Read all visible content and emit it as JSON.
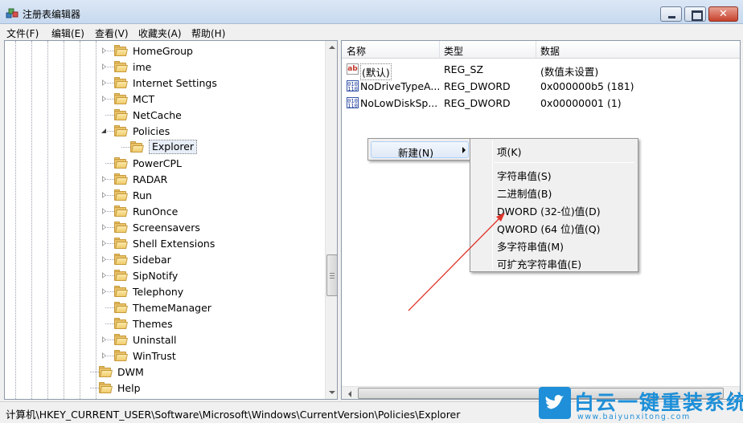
{
  "window": {
    "title": "注册表编辑器",
    "controls": {
      "minimize": "minimize",
      "maximize": "maximize",
      "close": "✕"
    }
  },
  "menu": [
    "文件(F)",
    "编辑(E)",
    "查看(V)",
    "收藏夹(A)",
    "帮助(H)"
  ],
  "tree": {
    "items": [
      {
        "label": "HomeGroup",
        "expander": "collapsed"
      },
      {
        "label": "ime",
        "expander": "collapsed"
      },
      {
        "label": "Internet Settings",
        "expander": "collapsed"
      },
      {
        "label": "MCT",
        "expander": "collapsed"
      },
      {
        "label": "NetCache",
        "expander": "none"
      },
      {
        "label": "Policies",
        "expander": "expanded"
      },
      {
        "label": "Explorer",
        "expander": "none",
        "selected": true
      },
      {
        "label": "PowerCPL",
        "expander": "none"
      },
      {
        "label": "RADAR",
        "expander": "collapsed"
      },
      {
        "label": "Run",
        "expander": "collapsed"
      },
      {
        "label": "RunOnce",
        "expander": "collapsed"
      },
      {
        "label": "Screensavers",
        "expander": "collapsed"
      },
      {
        "label": "Shell Extensions",
        "expander": "collapsed"
      },
      {
        "label": "Sidebar",
        "expander": "collapsed"
      },
      {
        "label": "SipNotify",
        "expander": "collapsed"
      },
      {
        "label": "Telephony",
        "expander": "collapsed"
      },
      {
        "label": "ThemeManager",
        "expander": "none"
      },
      {
        "label": "Themes",
        "expander": "none"
      },
      {
        "label": "Uninstall",
        "expander": "collapsed"
      },
      {
        "label": "WinTrust",
        "expander": "collapsed"
      },
      {
        "label": "DWM",
        "expander": "none"
      },
      {
        "label": "Help",
        "expander": "none"
      }
    ]
  },
  "list": {
    "columns": [
      "名称",
      "类型",
      "数据"
    ],
    "rows": [
      {
        "icon": "string-value-icon",
        "name": "(默认)",
        "type": "REG_SZ",
        "data": "(数值未设置)"
      },
      {
        "icon": "binary-value-icon",
        "name": "NoDriveTypeA...",
        "type": "REG_DWORD",
        "data": "0x000000b5 (181)"
      },
      {
        "icon": "binary-value-icon",
        "name": "NoLowDiskSp...",
        "type": "REG_DWORD",
        "data": "0x00000001 (1)"
      }
    ]
  },
  "context_menu": {
    "new_label": "新建(N)",
    "submenu": {
      "key": "项(K)",
      "items": [
        "字符串值(S)",
        "二进制值(B)",
        "DWORD (32-位)值(D)",
        "QWORD (64 位)值(Q)",
        "多字符串值(M)",
        "可扩充字符串值(E)"
      ]
    }
  },
  "status": {
    "path": "计算机\\HKEY_CURRENT_USER\\Software\\Microsoft\\Windows\\CurrentVersion\\Policies\\Explorer"
  },
  "watermark": {
    "title": "白云一键重装系统",
    "url": "www.baiyunxitong.com"
  },
  "colors": {
    "annotation_arrow": "#e0352b",
    "watermark": "#1e8fd8",
    "folder": "#e9c36a"
  }
}
